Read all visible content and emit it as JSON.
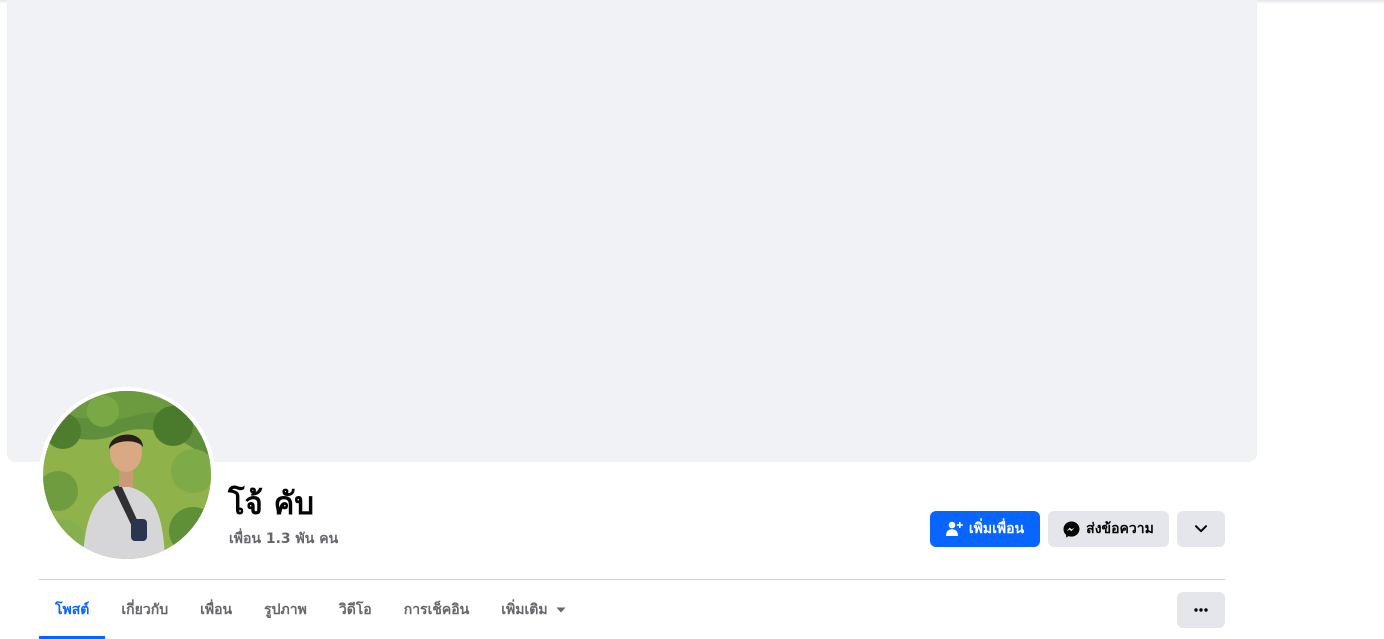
{
  "profile": {
    "name": "โจ้ คับ",
    "friends_count": "เพื่อน 1.3 พัน คน"
  },
  "actions": {
    "add_friend_label": "เพิ่มเพื่อน",
    "message_label": "ส่งข้อความ"
  },
  "tabs": [
    {
      "label": "โพสต์",
      "active": true
    },
    {
      "label": "เกี่ยวกับ",
      "active": false
    },
    {
      "label": "เพื่อน",
      "active": false
    },
    {
      "label": "รูปภาพ",
      "active": false
    },
    {
      "label": "วิดีโอ",
      "active": false
    },
    {
      "label": "การเช็คอิน",
      "active": false
    },
    {
      "label": "เพิ่มเติม",
      "active": false
    }
  ],
  "icons": {
    "add_friend": "person-plus-icon",
    "message": "messenger-icon",
    "expand": "chevron-down-icon",
    "more_tab": "caret-down-icon",
    "options": "more-dots-icon"
  },
  "colors": {
    "accent": "#0866ff",
    "secondary_button": "#e4e6eb",
    "cover": "#f0f2f5",
    "muted_text": "#65676b"
  }
}
